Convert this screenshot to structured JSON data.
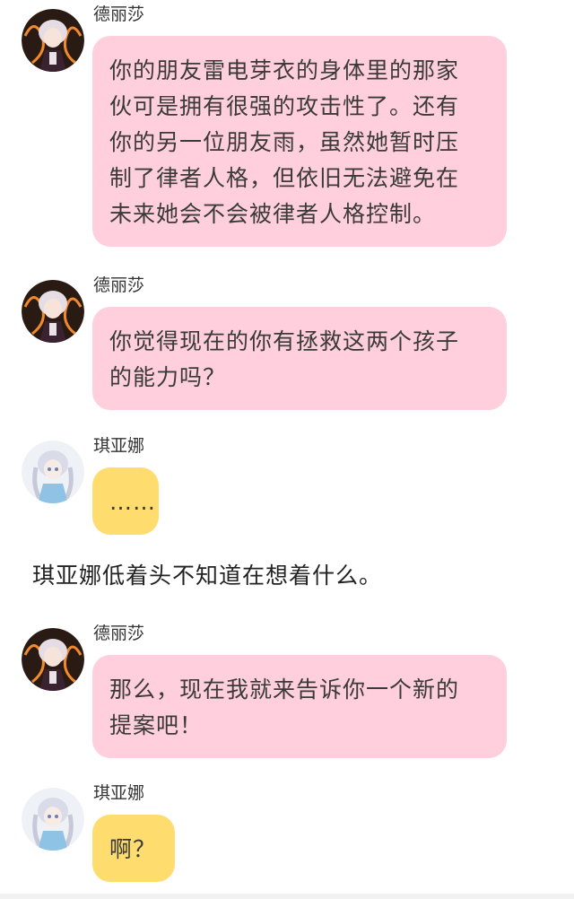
{
  "colors": {
    "pink_bubble": "#ffcfdd",
    "yellow_bubble": "#ffdc6e",
    "background": "#ffffff"
  },
  "messages": [
    {
      "speaker": "德丽莎",
      "avatar": "theresa-avatar",
      "bubble": "pink",
      "lines": [
        "你的朋友雷电芽衣的身体里的那家",
        "伙可是拥有很强的攻击性了。还有",
        "你的另一位朋友雨，虽然她暂时压",
        "制了律者人格，但依旧无法避免在",
        "未来她会不会被律者人格控制。"
      ]
    },
    {
      "speaker": "德丽莎",
      "avatar": "theresa-avatar",
      "bubble": "pink",
      "lines": [
        "你觉得现在的你有拯救这两个孩子",
        "的能力吗？"
      ]
    },
    {
      "speaker": "琪亚娜",
      "avatar": "kiana-avatar",
      "bubble": "yellow",
      "lines": [
        "……"
      ]
    },
    {
      "speaker": "德丽莎",
      "avatar": "theresa-avatar",
      "bubble": "pink",
      "lines": [
        "那么，现在我就来告诉你一个新的",
        "提案吧！"
      ]
    },
    {
      "speaker": "琪亚娜",
      "avatar": "kiana-avatar",
      "bubble": "yellow",
      "lines": [
        "啊？"
      ]
    }
  ],
  "narration": "琪亚娜低着头不知道在想着什么。"
}
